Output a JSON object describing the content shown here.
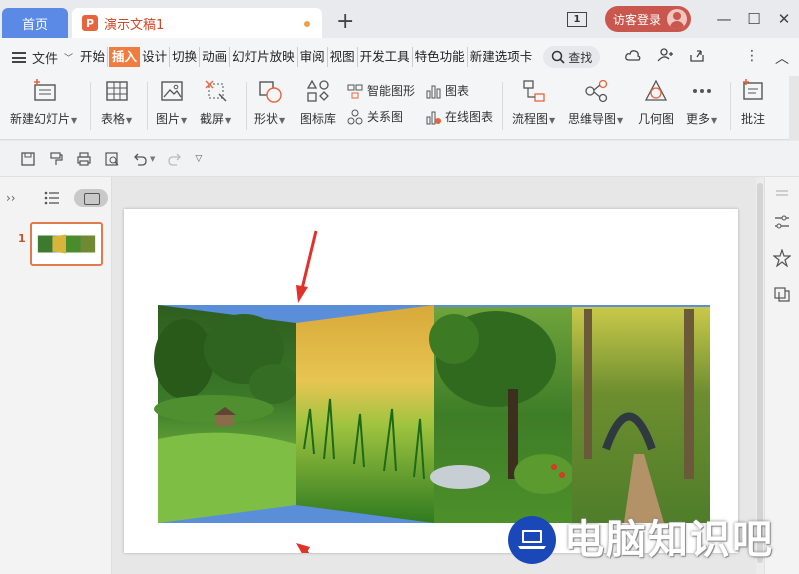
{
  "tabs": {
    "home_label": "首页",
    "doc_label": "演示文稿1",
    "doc_badge": "P",
    "add_label": "+"
  },
  "window": {
    "badge_number": "1",
    "visitor_label": "访客登录",
    "minimize": "—",
    "maximize": "☐",
    "close": "✕"
  },
  "menu": {
    "file_label": "文件",
    "items": [
      "开始",
      "插入",
      "设计",
      "切换",
      "动画",
      "幻灯片放映",
      "审阅",
      "视图",
      "开发工具",
      "特色功能",
      "新建选项卡"
    ],
    "active_item": "插入",
    "search_label": "查找"
  },
  "ribbon": {
    "new_slide": "新建幻灯片",
    "table": "表格",
    "picture": "图片",
    "screenshot": "截屏",
    "shape": "形状",
    "icon_library": "图标库",
    "smart_graphic": "智能图形",
    "relation_chart": "关系图",
    "chart": "图表",
    "online_chart": "在线图表",
    "flowchart": "流程图",
    "mind_map": "思维导图",
    "geometry": "几何图",
    "more": "更多",
    "comment": "批注"
  },
  "slides_panel": {
    "slide_number": "1"
  },
  "watermark": {
    "text": "电脑知识吧"
  },
  "colors": {
    "accent_orange": "#f07c3e",
    "home_tab_blue": "#5b8ae6",
    "visitor_red": "#c9574e",
    "arrow_red": "#e0322b",
    "watermark_blue": "#1a48b8",
    "slide_blue_bg": "#5b8ed8"
  }
}
